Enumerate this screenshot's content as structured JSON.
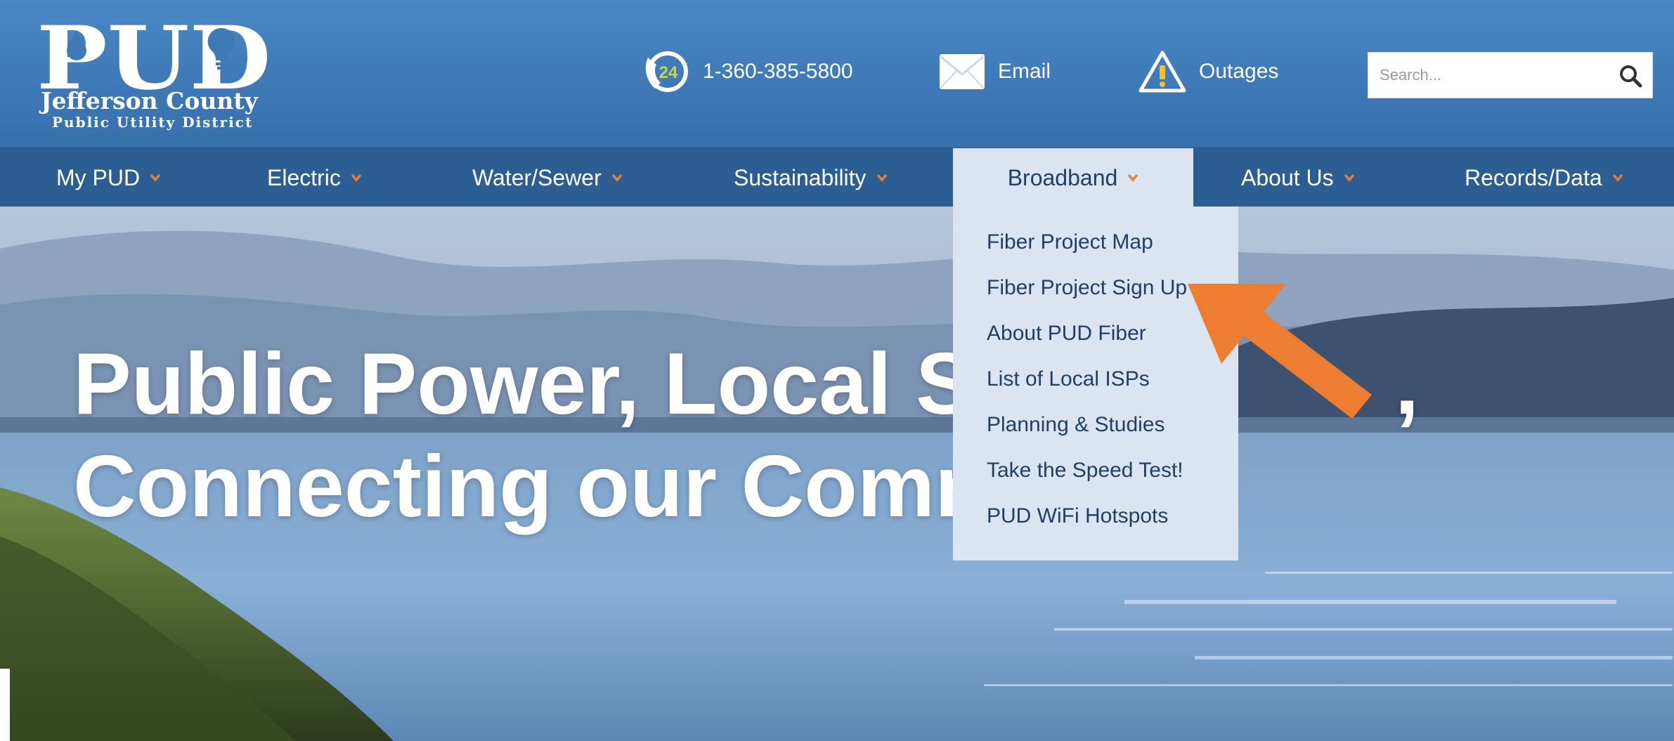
{
  "brand": {
    "logo_main": "PUD",
    "logo_line1": "Jefferson County",
    "logo_line2": "Public Utility District"
  },
  "header": {
    "phone_label": "1-360-385-5800",
    "phone_badge": "24",
    "email_label": "Email",
    "outages_label": "Outages",
    "search_placeholder": "Search..."
  },
  "nav": {
    "items": [
      {
        "label": "My PUD"
      },
      {
        "label": "Electric"
      },
      {
        "label": "Water/Sewer"
      },
      {
        "label": "Sustainability"
      },
      {
        "label": "Broadband"
      },
      {
        "label": "About Us"
      },
      {
        "label": "Records/Data"
      }
    ],
    "active": "Broadband"
  },
  "dropdown": {
    "items": [
      {
        "label": "Fiber Project Map"
      },
      {
        "label": "Fiber Project Sign Up"
      },
      {
        "label": "About PUD Fiber"
      },
      {
        "label": "List of Local ISPs"
      },
      {
        "label": "Planning & Studies"
      },
      {
        "label": "Take the Speed Test!"
      },
      {
        "label": "PUD WiFi Hotspots"
      }
    ]
  },
  "hero": {
    "line1": "Public Power, Local Se",
    "line1_end": ",",
    "line2": "Connecting our Comm"
  },
  "colors": {
    "header_blue": "#4a87c5",
    "nav_blue": "#2d5e93",
    "dropdown_bg": "#dbe5f1",
    "accent_orange": "#ed7d31",
    "nav_text_dark": "#1f3f66"
  },
  "icons": {
    "phone": "phone-24-icon",
    "email": "envelope-icon",
    "outages": "warning-triangle-icon",
    "search": "search-icon",
    "chevron": "chevron-down-icon",
    "annotation": "arrow-icon"
  }
}
